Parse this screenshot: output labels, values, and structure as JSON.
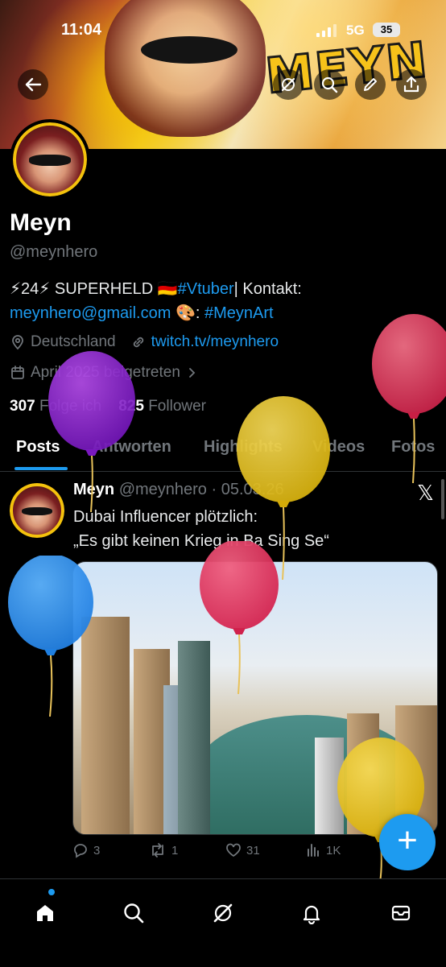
{
  "status_bar": {
    "time": "11:04",
    "network": "5G",
    "battery": "35"
  },
  "banner": {
    "logo_text": "MEYN"
  },
  "profile": {
    "name": "Meyn",
    "handle": "@meynhero",
    "bio": {
      "part1": "⚡24⚡ SUPERHELD 🇩🇪",
      "hashtag_vtuber": "#Vtuber",
      "part2": "| Kontakt:",
      "email": "meynhero@gmail.com",
      "part3": "🎨: ",
      "hashtag_art": "#MeynArt"
    },
    "location": "Deutschland",
    "website": "twitch.tv/meynhero",
    "joined": "April 2025 beigetreten",
    "following_count": "307",
    "following_label": "Folge ich",
    "followers_count": "825",
    "followers_label": "Follower"
  },
  "tabs": [
    {
      "label": "Posts",
      "active": true
    },
    {
      "label": "Antworten"
    },
    {
      "label": "Highlights"
    },
    {
      "label": "Videos"
    },
    {
      "label": "Fotos"
    }
  ],
  "post": {
    "author_name": "Meyn",
    "author_handle": "@meynhero",
    "date": "05.03.26",
    "text": "Dubai Influencer plötzlich:\n„Es gibt keinen Krieg in Ba Sing Se“",
    "replies": "3",
    "reposts": "1",
    "likes": "31",
    "views": "1K"
  },
  "fab": {
    "label": "+"
  },
  "colors": {
    "accent": "#1d9bf0",
    "background": "#000000",
    "secondary_text": "#71767b",
    "avatar_ring": "#f4c20d"
  },
  "icons": {
    "back": "arrow-left-icon",
    "grok": "grok-icon",
    "search": "search-icon",
    "edit": "pencil-icon",
    "share": "share-icon",
    "location": "location-pin-icon",
    "link": "link-icon",
    "calendar": "calendar-icon",
    "nav": [
      "home-icon",
      "search-icon",
      "grok-icon",
      "bell-icon",
      "mail-icon"
    ]
  }
}
